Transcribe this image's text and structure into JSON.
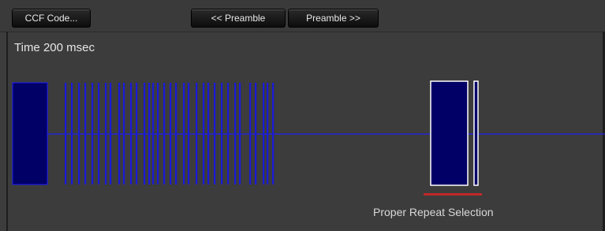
{
  "toolbar": {
    "ccf_label": "CCF Code...",
    "prev_preamble_label": "<< Preamble",
    "next_preamble_label": "Preamble >>"
  },
  "time_label": "Time 200 msec",
  "repeat_label": "Proper Repeat Selection",
  "colors": {
    "signal": "#000066",
    "signal_stroke": "#1a1aff",
    "baseline": "#2424d0",
    "selection_outline": "#ffffff",
    "repeat_marker": "#c0282b"
  }
}
